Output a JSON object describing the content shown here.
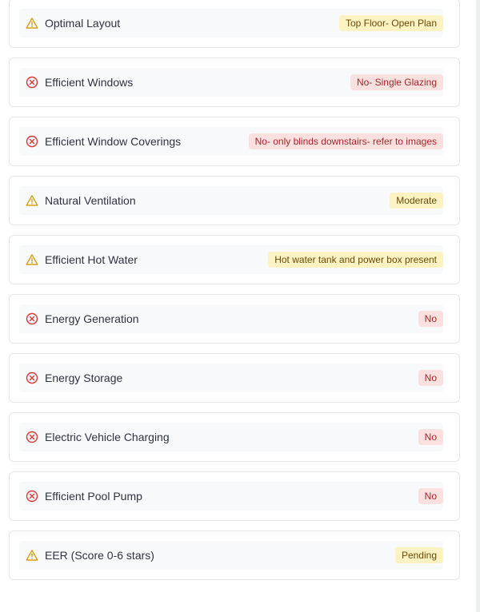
{
  "colors": {
    "warning": "#d4a017",
    "error": "#d93a3a",
    "warning_badge_bg": "#fdf3c2",
    "error_badge_bg": "#fbe0e0"
  },
  "items": [
    {
      "label": "Optimal Layout",
      "status": "warning",
      "icon": "warning-triangle-icon",
      "value": "Top Floor- Open Plan"
    },
    {
      "label": "Efficient Windows",
      "status": "error",
      "icon": "x-circle-icon",
      "value": "No- Single Glazing"
    },
    {
      "label": "Efficient Window Coverings",
      "status": "error",
      "icon": "x-circle-icon",
      "value": "No- only blinds downstairs- refer to images"
    },
    {
      "label": "Natural Ventilation",
      "status": "warning",
      "icon": "warning-triangle-icon",
      "value": "Moderate"
    },
    {
      "label": "Efficient Hot Water",
      "status": "warning",
      "icon": "warning-triangle-icon",
      "value": "Hot water tank and power box present"
    },
    {
      "label": "Energy Generation",
      "status": "error",
      "icon": "x-circle-icon",
      "value": "No"
    },
    {
      "label": "Energy Storage",
      "status": "error",
      "icon": "x-circle-icon",
      "value": "No"
    },
    {
      "label": "Electric Vehicle Charging",
      "status": "error",
      "icon": "x-circle-icon",
      "value": "No"
    },
    {
      "label": "Efficient Pool Pump",
      "status": "error",
      "icon": "x-circle-icon",
      "value": "No"
    },
    {
      "label": "EER (Score 0-6 stars)",
      "status": "warning",
      "icon": "warning-triangle-icon",
      "value": "Pending"
    }
  ]
}
